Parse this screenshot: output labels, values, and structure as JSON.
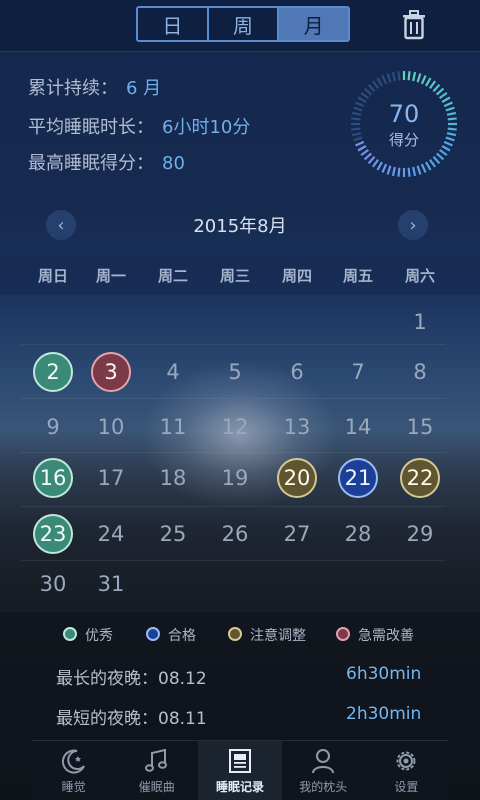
{
  "header": {
    "segments": [
      {
        "label": "日",
        "active": false
      },
      {
        "label": "周",
        "active": false
      },
      {
        "label": "月",
        "active": true
      }
    ],
    "delete_icon": "trash-icon"
  },
  "stats": {
    "duration_label": "累计持续：",
    "duration_value": "6 月",
    "avg_sleep_label": "平均睡眠时长：",
    "avg_sleep_value": "6小时10分",
    "best_score_label": "最高睡眠得分：",
    "best_score_value": "80"
  },
  "gauge": {
    "score": "70",
    "label": "得分",
    "level": 0.7,
    "colors": {
      "low": "#2e4c7d",
      "start": "#5fd3b8",
      "mid": "#4fa6e8",
      "end": "#7b8ff0"
    }
  },
  "calendar": {
    "title": "2015年8月",
    "weekdays": [
      "周日",
      "周一",
      "周二",
      "周三",
      "周四",
      "周五",
      "周六"
    ],
    "rows": [
      [
        null,
        null,
        null,
        null,
        null,
        null,
        {
          "d": "1"
        }
      ],
      [
        {
          "d": "2",
          "s": "good"
        },
        {
          "d": "3",
          "s": "bad"
        },
        {
          "d": "4"
        },
        {
          "d": "5"
        },
        {
          "d": "6"
        },
        {
          "d": "7"
        },
        {
          "d": "8"
        }
      ],
      [
        {
          "d": "9"
        },
        {
          "d": "10"
        },
        {
          "d": "11"
        },
        {
          "d": "12"
        },
        {
          "d": "13"
        },
        {
          "d": "14"
        },
        {
          "d": "15"
        }
      ],
      [
        {
          "d": "16",
          "s": "good"
        },
        {
          "d": "17"
        },
        {
          "d": "18"
        },
        {
          "d": "19"
        },
        {
          "d": "20",
          "s": "warn"
        },
        {
          "d": "21",
          "s": "pass"
        },
        {
          "d": "22",
          "s": "warn"
        }
      ],
      [
        {
          "d": "23",
          "s": "good"
        },
        {
          "d": "24"
        },
        {
          "d": "25"
        },
        {
          "d": "26"
        },
        {
          "d": "27"
        },
        {
          "d": "28"
        },
        {
          "d": "29"
        }
      ],
      [
        {
          "d": "30"
        },
        {
          "d": "31"
        },
        null,
        null,
        null,
        null,
        null
      ]
    ]
  },
  "legend": [
    {
      "label": "优秀",
      "key": "good",
      "fill": "#3b8a78",
      "ring": "#bfe9d9"
    },
    {
      "label": "合格",
      "key": "pass",
      "fill": "#1c3f9a",
      "ring": "#9cbcf2"
    },
    {
      "label": "注意调整",
      "key": "warn",
      "fill": "#5f5530",
      "ring": "#d6c892"
    },
    {
      "label": "急需改善",
      "key": "bad",
      "fill": "#7a3a48",
      "ring": "#e6a2ab"
    }
  ],
  "nights": {
    "longest_label": "最长的夜晚：08.12",
    "longest_value": "6h30min",
    "shortest_label": "最短的夜晚：08.11",
    "shortest_value": "2h30min"
  },
  "tabs": [
    {
      "label": "睡觉",
      "icon": "moon-icon",
      "active": false
    },
    {
      "label": "催眠曲",
      "icon": "music-note-icon",
      "active": false
    },
    {
      "label": "睡眠记录",
      "icon": "record-sheet-icon",
      "active": true
    },
    {
      "label": "我的枕头",
      "icon": "user-icon",
      "active": false
    },
    {
      "label": "设置",
      "icon": "gear-icon",
      "active": false
    }
  ]
}
